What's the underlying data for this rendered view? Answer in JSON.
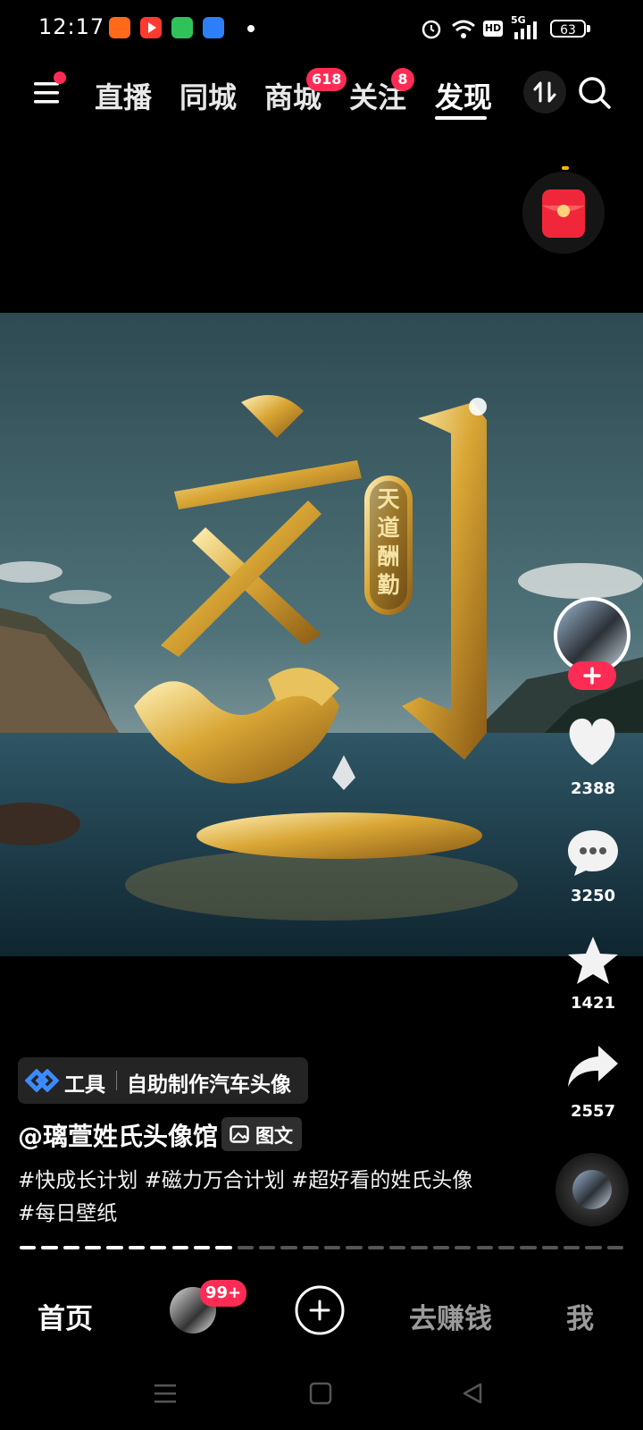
{
  "status_bar": {
    "time": "12:17",
    "network": "5G",
    "hd_label": "HD",
    "battery": "63"
  },
  "top_nav": {
    "tabs": [
      {
        "label": "直播",
        "badge": ""
      },
      {
        "label": "同城",
        "badge": ""
      },
      {
        "label": "商城",
        "badge": "618"
      },
      {
        "label": "关注",
        "badge": "8"
      },
      {
        "label": "发现",
        "badge": ""
      }
    ],
    "active_tab": "发现"
  },
  "image": {
    "character": "刘",
    "plaque_text": "天道酬勤"
  },
  "actions": {
    "likes": "2388",
    "comments": "3250",
    "favorites": "1421",
    "shares": "2557"
  },
  "caption": {
    "tool_label": "工具",
    "tool_name": "自助制作汽车头像",
    "author": "@璃萱姓氏头像馆",
    "post_type": "图文",
    "hashtags": "#快成长计划 #磁力万合计划 #超好看的姓氏头像 #每日壁纸"
  },
  "progress": {
    "total_segments": 28,
    "viewed_segments": 10
  },
  "bottom_nav": {
    "home": "首页",
    "avatar_badge": "99+",
    "earn": "去赚钱",
    "me": "我"
  },
  "colors": {
    "accent": "#fe2c55",
    "background": "#000000",
    "tool_icon": "#3a8bff"
  }
}
